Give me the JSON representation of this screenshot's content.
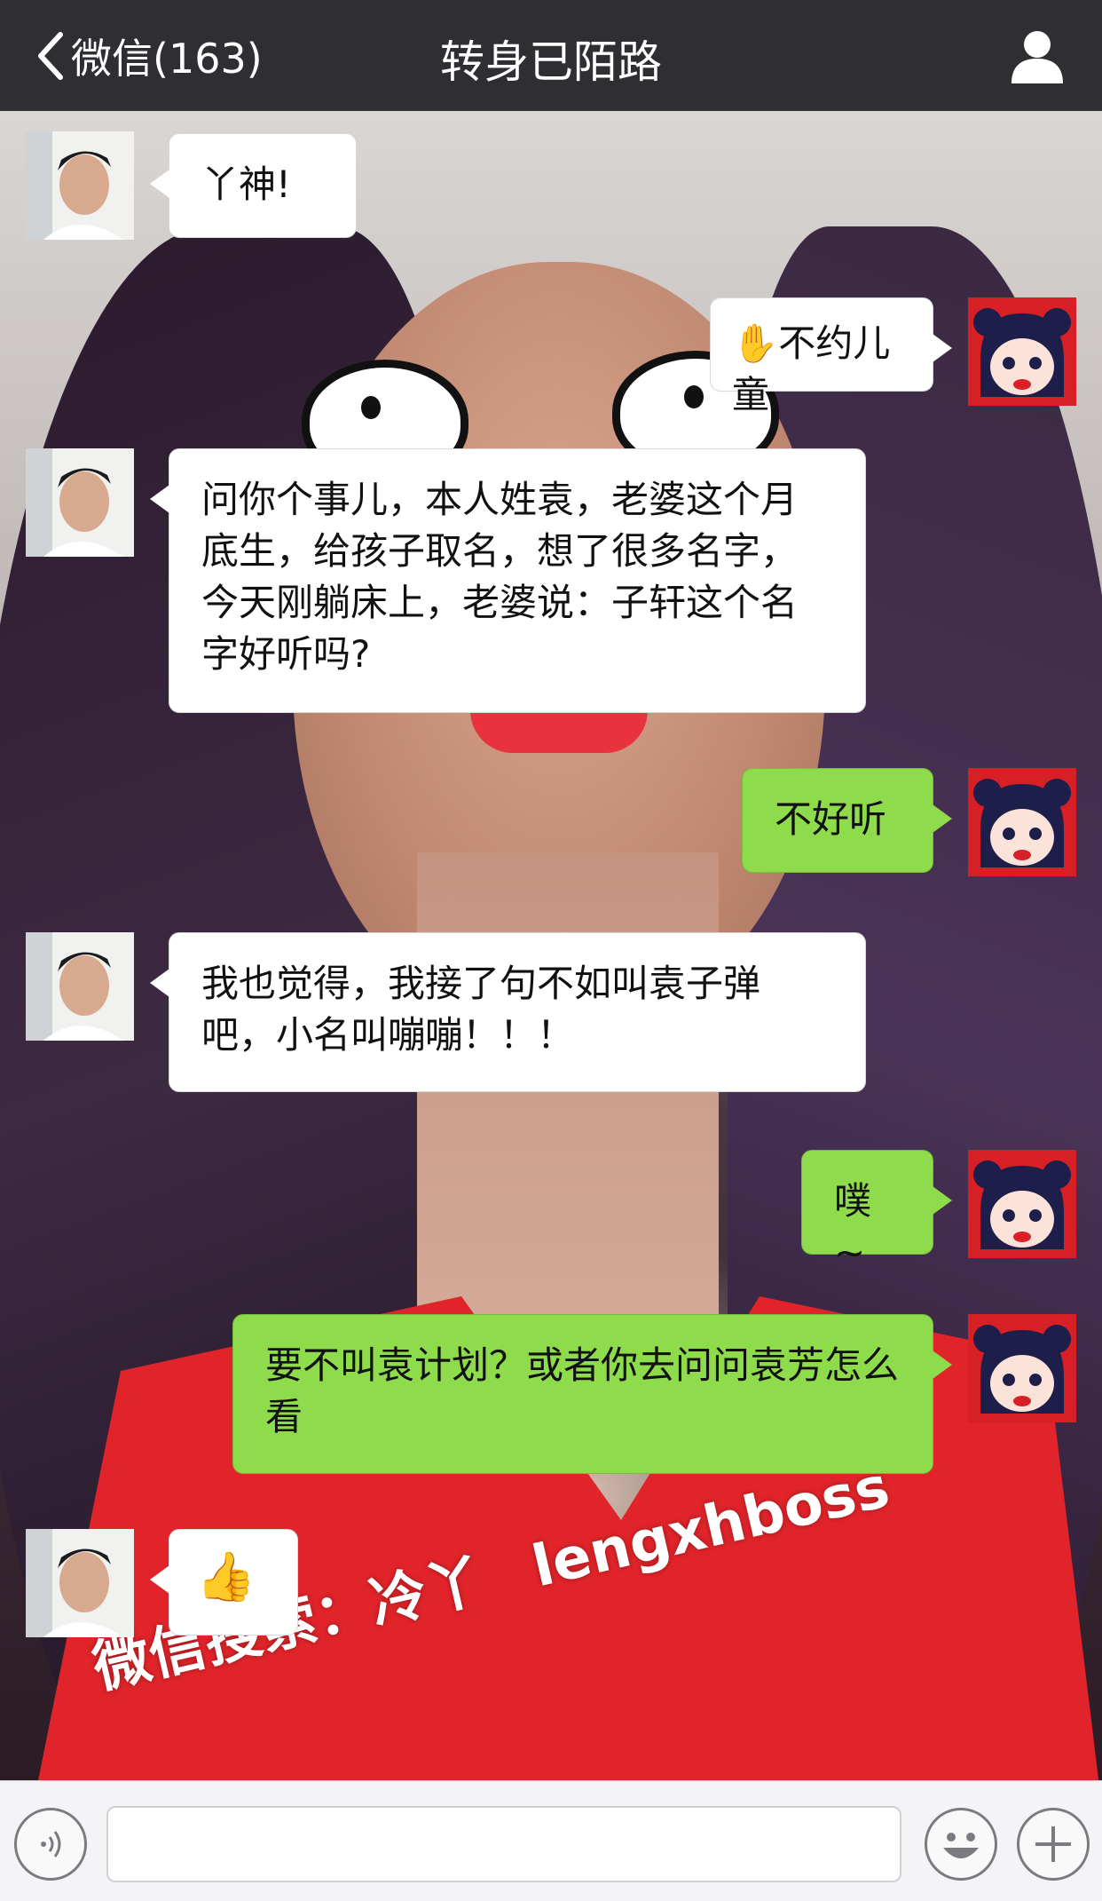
{
  "header": {
    "back_label": "微信(163)",
    "title": "转身已陌路",
    "back_icon": "chevron-left-icon",
    "profile_icon": "person-icon"
  },
  "messages": [
    {
      "side": "left",
      "text": "丫神!"
    },
    {
      "side": "right",
      "text": "不约儿童",
      "emoji": "✋",
      "style": "white"
    },
    {
      "side": "left",
      "text": "问你个事儿，本人姓袁，老婆这个月底生，给孩子取名，想了很多名字，今天刚躺床上，老婆说：子轩这个名字好听吗?"
    },
    {
      "side": "right",
      "text": "不好听",
      "style": "green"
    },
    {
      "side": "left",
      "text": "我也觉得，我接了句不如叫袁子弹吧，小名叫嘣嘣！！！"
    },
    {
      "side": "right",
      "text": "噗~",
      "style": "green"
    },
    {
      "side": "right",
      "text": "要不叫袁计划？或者你去问问袁芳怎么看",
      "style": "green"
    },
    {
      "side": "left",
      "emoji": "👍",
      "text": ""
    }
  ],
  "watermark": {
    "text": "微信搜索：冷丫",
    "handle": "lengxhboss"
  },
  "input_bar": {
    "voice_icon": "voice-icon",
    "emoji_icon": "smiley-icon",
    "add_icon": "plus-icon",
    "text_value": ""
  },
  "colors": {
    "header_bg": "#2e2e33",
    "sent_bubble": "#8edb4c",
    "received_bubble": "#ffffff",
    "dress_red": "#e0242a"
  }
}
